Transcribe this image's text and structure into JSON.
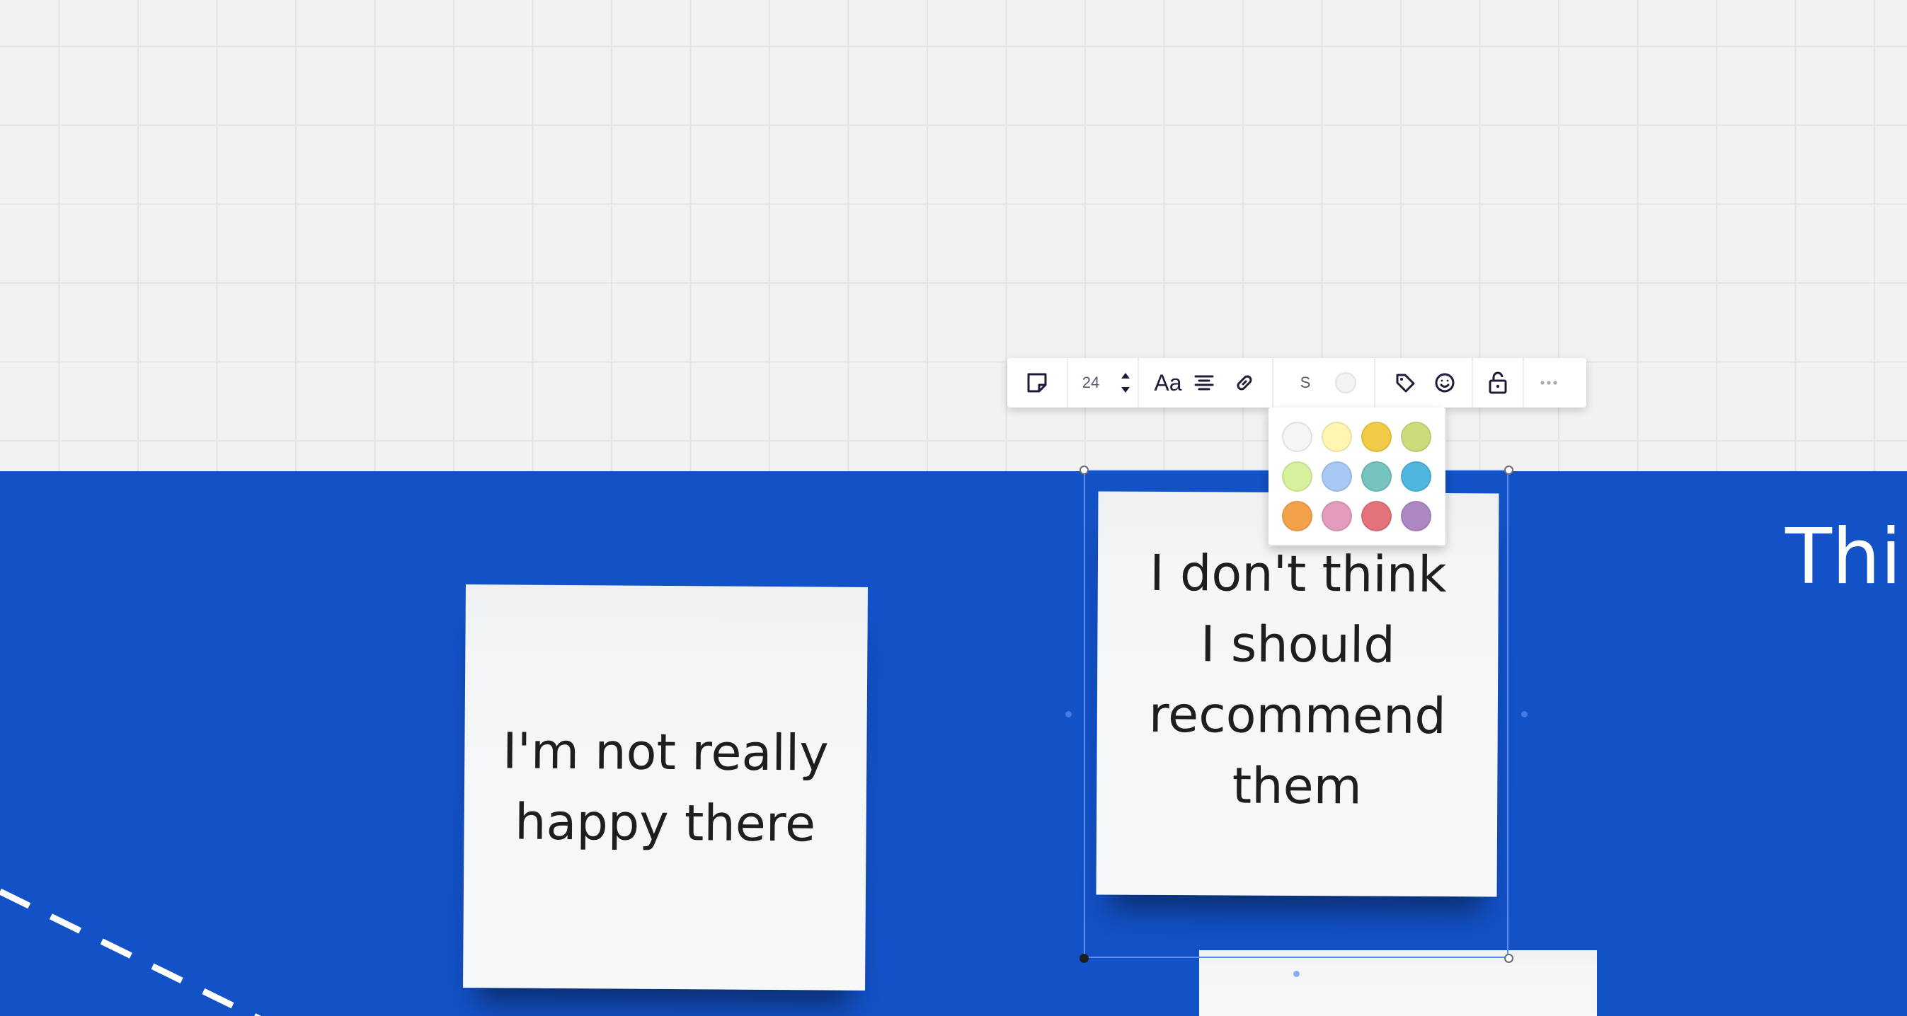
{
  "frame": {
    "title": "Thin",
    "background": "#1351c6"
  },
  "stickies": [
    {
      "text": "I'm not really happy there",
      "color": "#f5f6f8"
    },
    {
      "text": "I don't think I should recommend them",
      "color": "#f5f6f8"
    },
    {
      "text": "",
      "color": "#f5f6f8"
    }
  ],
  "toolbar": {
    "sticky_type_icon": "sticky-note-icon",
    "font_size": "24",
    "font_label": "Aa",
    "align_icon": "align-center-icon",
    "link_icon": "link-icon",
    "size_label": "S",
    "tag_icon": "tag-icon",
    "emoji_icon": "smiley-icon",
    "lock_icon": "lock-icon",
    "more_icon": "more-icon"
  },
  "palette": {
    "colors": [
      "#f4f5f7",
      "#fef6b0",
      "#f1cb45",
      "#cedb7c",
      "#d6f09c",
      "#a8c9f3",
      "#75c4bf",
      "#4fb6e0",
      "#f4a14c",
      "#e59bbd",
      "#e4727a",
      "#ad87c3"
    ]
  }
}
